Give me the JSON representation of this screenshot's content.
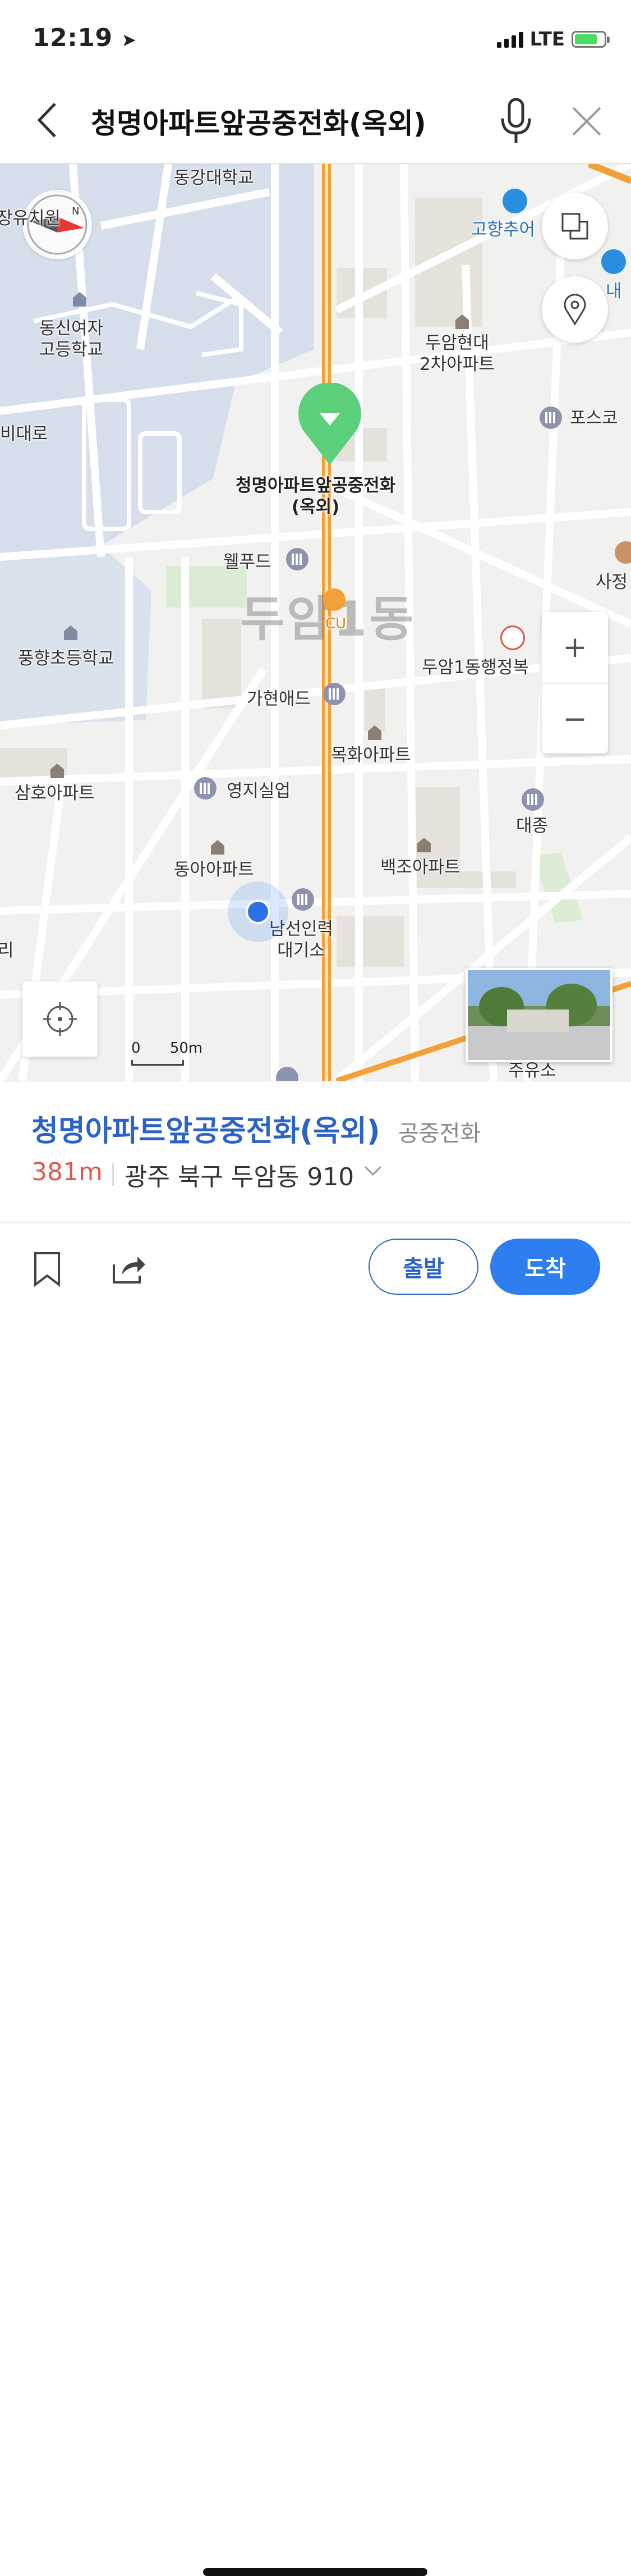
{
  "status_bar": {
    "time": "12:19",
    "network": "LTE"
  },
  "search": {
    "query": "청명아파트앞공중전화(옥외)"
  },
  "map": {
    "district_label": "두암1동",
    "selected_marker_label": "청명아파트앞공중전화\n(옥외)",
    "labels": {
      "donggang_univ": "동강대학교",
      "dongshin_girls_high": "동신여자\n고등학교",
      "duam_hyundai": "두암현대\n2차아파트",
      "gohyang": "고향추어",
      "posco": "포스코",
      "bidaero": "비대로",
      "wellfood": "웰푸드",
      "cu": "CU",
      "sajeong": "사정",
      "punghyang_elem": "풍향초등학교",
      "duam1_office": "두암1동행정복",
      "gahyun_ad": "가현애드",
      "mokhwa_apt": "목화아파트",
      "youngji": "영지실업",
      "samho_apt": "삼호아파트",
      "daejong": "대종",
      "donga_apt": "동아아파트",
      "baekjo_apt": "백조아파트",
      "namseon": "남선인력\n대기소",
      "gas_station": "주유소",
      "left_edge_1": "장유치원",
      "left_edge_2": "리",
      "right_edge_1": "내",
      "juyuso_top": "주유소"
    },
    "scale": {
      "zero": "0",
      "distance": "50m"
    },
    "zoom_in": "+",
    "zoom_out": "−"
  },
  "place": {
    "name": "청명아파트앞공중전화(옥외)",
    "category": "공중전화",
    "distance": "381m",
    "address": "광주 북구 두암동 910"
  },
  "actions": {
    "start": "출발",
    "arrive": "도착"
  },
  "colors": {
    "accent": "#2c63c7",
    "arrive": "#2e7ef0",
    "distance": "#e3574b",
    "marker": "#5ccf7a",
    "road_major": "#f2a13a"
  }
}
